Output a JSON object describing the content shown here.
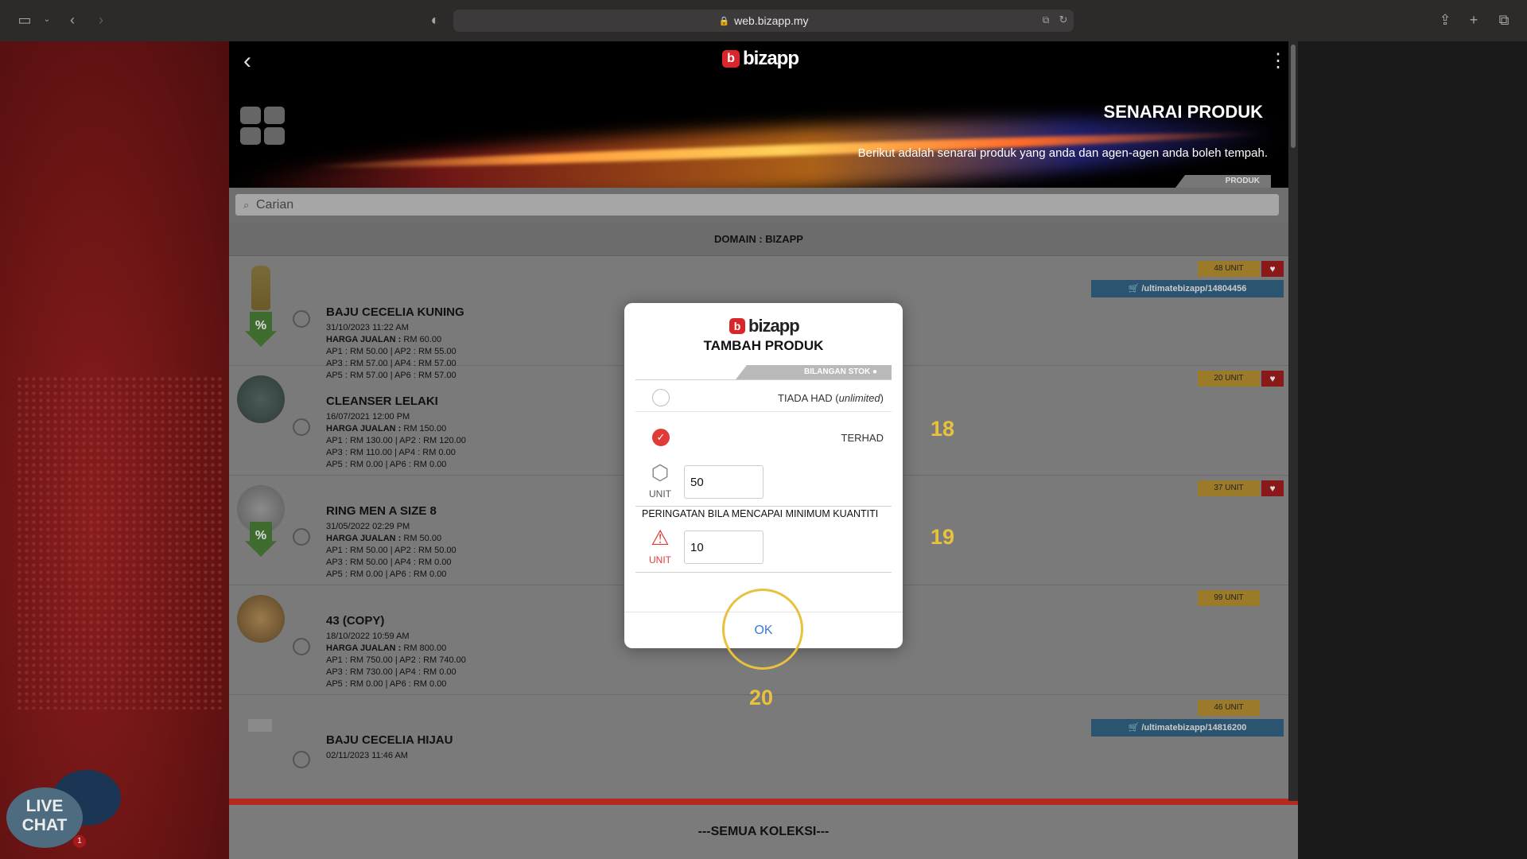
{
  "browser": {
    "url": "web.bizapp.my"
  },
  "header": {
    "logo_text": "bizapp",
    "page_title": "SENARAI PRODUK",
    "subtitle": "Berikut adalah senarai produk yang anda dan agen-agen anda boleh tempah.",
    "tab_label": "PRODUK"
  },
  "search": {
    "placeholder": "Carian"
  },
  "domain_label": "DOMAIN : BIZAPP",
  "products": [
    {
      "name": "BAJU CECELIA KUNING",
      "date": "31/10/2023 11:22 AM",
      "harga_label": "HARGA JUALAN :",
      "harga": "RM 60.00",
      "ap_line1": "AP1 : RM 50.00 | AP2 : RM 55.00",
      "ap_line2": "AP3 : RM 57.00 | AP4 : RM 57.00",
      "ap_line3": "AP5 : RM 57.00 | AP6 : RM 57.00",
      "stock": "48 UNIT",
      "link": "/ultimatebizapp/14804456"
    },
    {
      "name": "CLEANSER LELAKI",
      "date": "16/07/2021 12:00 PM",
      "harga_label": "HARGA JUALAN :",
      "harga": "RM 150.00",
      "ap_line1": "AP1 : RM 130.00 | AP2 : RM 120.00",
      "ap_line2": "AP3 : RM 110.00 | AP4 : RM 0.00",
      "ap_line3": "AP5 : RM 0.00 | AP6 : RM 0.00",
      "stock": "20 UNIT"
    },
    {
      "name": "RING MEN A SIZE 8",
      "date": "31/05/2022 02:29 PM",
      "harga_label": "HARGA JUALAN :",
      "harga": "RM 50.00",
      "ap_line1": "AP1 : RM 50.00 | AP2 : RM 50.00",
      "ap_line2": "AP3 : RM 50.00 | AP4 : RM 0.00",
      "ap_line3": "AP5 : RM 0.00 | AP6 : RM 0.00",
      "stock": "37 UNIT"
    },
    {
      "name": "43 (COPY)",
      "date": "18/10/2022 10:59 AM",
      "harga_label": "HARGA JUALAN :",
      "harga": "RM 800.00",
      "ap_line1": "AP1 : RM 750.00 | AP2 : RM 740.00",
      "ap_line2": "AP3 : RM 730.00 | AP4 : RM 0.00",
      "ap_line3": "AP5 : RM 0.00 | AP6 : RM 0.00",
      "stock": "99 UNIT"
    },
    {
      "name": "BAJU CECELIA HIJAU",
      "date": "02/11/2023 11:46 AM",
      "stock": "46 UNIT",
      "link": "/ultimatebizapp/14816200"
    }
  ],
  "footer": {
    "collection_label": "---SEMUA KOLEKSI---"
  },
  "live_chat": {
    "line1": "LIVE",
    "line2": "CHAT",
    "badge": "1"
  },
  "modal": {
    "logo_text": "bizapp",
    "title": "TAMBAH PRODUK",
    "tab_label": "BILANGAN STOK",
    "option_unlimited": "TIADA HAD",
    "option_unlimited_em": "unlimited",
    "option_limited": "TERHAD",
    "unit_label": "UNIT",
    "stock_value": "50",
    "warning_label": "PERINGATAN BILA MENCAPAI MINIMUM KUANTITI",
    "min_value": "10",
    "ok_label": "OK",
    "selected_option": "TERHAD"
  },
  "annotations": {
    "step_a": "18",
    "step_b": "19",
    "step_c": "20"
  },
  "colors": {
    "brand_red": "#d9262a",
    "annotation_yellow": "#e8c23c",
    "ok_blue": "#3a7bd5"
  }
}
